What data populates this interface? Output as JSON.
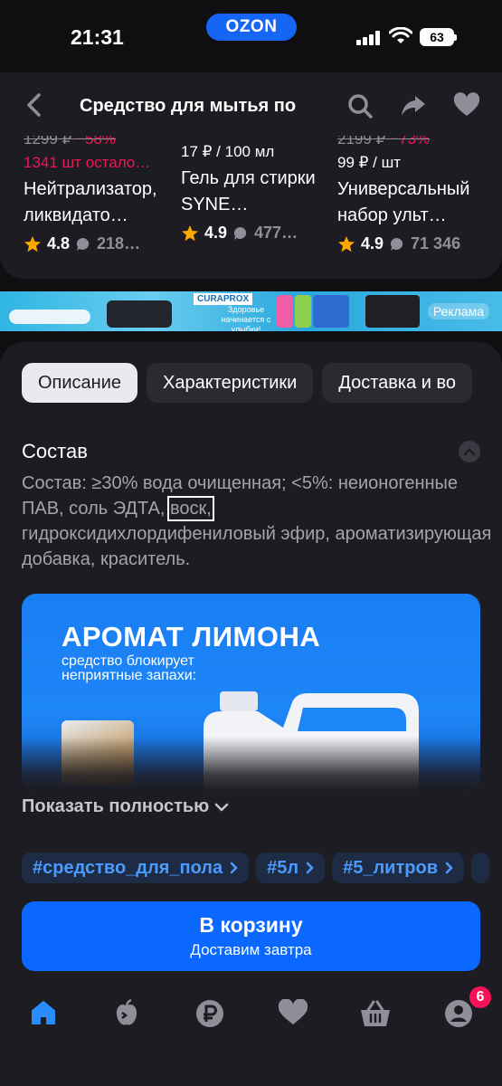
{
  "status_bar": {
    "time": "21:31",
    "brand": "OZON",
    "battery": "63"
  },
  "nav": {
    "title": "Средство для мытья по",
    "icons": [
      "back-arrow",
      "search",
      "share",
      "heart"
    ]
  },
  "recommended": [
    {
      "old_price": "1299 ₽",
      "discount": "−58%",
      "stock": "1341 шт остало…",
      "price": "",
      "name": "Нейтрализатор, ликвидато…",
      "rating": "4.8",
      "reviews": "218…"
    },
    {
      "old_price": "",
      "discount": "",
      "stock": "",
      "price": "17 ₽ / 100 мл",
      "name": "Гель для стирки SYNE…",
      "rating": "4.9",
      "reviews": "477…"
    },
    {
      "old_price": "2199 ₽",
      "discount": "−73%",
      "stock": "",
      "price": "99 ₽ / шт",
      "name": "Универсальный набор ульт…",
      "rating": "4.9",
      "reviews": "71 346"
    }
  ],
  "ad_banner": {
    "brand": "CURAPROX",
    "slogan": "Здоровье начинается с улыбки!",
    "ad_label": "Реклама"
  },
  "tabs": [
    "Описание",
    "Характеристики",
    "Доставка и во"
  ],
  "active_tab": 0,
  "composition": {
    "title": "Состав",
    "text_before": "Состав: ≥30% вода очищенная; <5%: неионогенные ПАВ, соль ЭДТА,",
    "text_highlight": "воск,",
    "text_after": "гидроксидихлордифениловый эфир, ароматизирующая добавка, краситель."
  },
  "promo": {
    "title": "АРОМАТ ЛИМОНА",
    "subtitle": "средство блокирует неприятные запахи:"
  },
  "show_all": "Показать полностью",
  "tags": [
    "#средство_для_пола",
    "#5л",
    "#5_литров"
  ],
  "cart_button": {
    "label": "В корзину",
    "sublabel": "Доставим завтра"
  },
  "tab_bar": {
    "items": [
      "home",
      "fresh",
      "payments",
      "favorites",
      "cart",
      "profile"
    ],
    "profile_badge": "6"
  },
  "colors": {
    "accent": "#0a68ff",
    "discount": "#f91155",
    "background": "#0f0f12",
    "card": "#1c1c22"
  }
}
